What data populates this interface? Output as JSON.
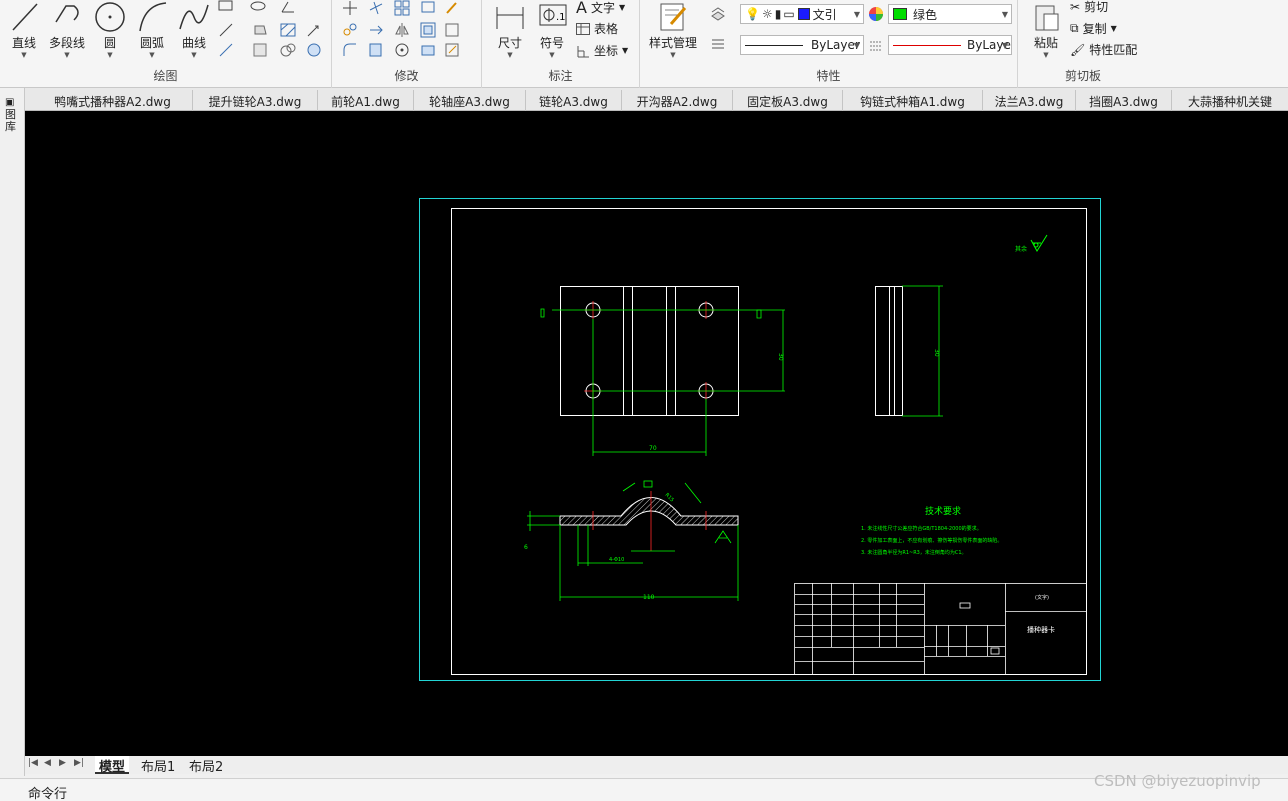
{
  "ribbon": {
    "draw": {
      "title": "绘图",
      "tools": [
        "直线",
        "多段线",
        "圆",
        "圆弧",
        "曲线"
      ]
    },
    "modify": {
      "title": "修改"
    },
    "annotate": {
      "title": "标注",
      "dimension": "尺寸",
      "symbol": "符号",
      "text": "文字",
      "table": "表格",
      "coordinate": "坐标"
    },
    "properties": {
      "title": "特性",
      "style_manager": "样式管理",
      "layer_value": "文引",
      "color_value": "绿色",
      "linetype_value": "ByLayer",
      "lineweight_value": "ByLaye",
      "color_hex": "#00dd00"
    },
    "clipboard": {
      "title": "剪切板",
      "paste": "粘贴",
      "cut": "剪切",
      "copy": "复制",
      "match": "特性匹配"
    }
  },
  "side_panel": {
    "label": "图库"
  },
  "doc_tabs": [
    "鸭嘴式播种器A2.dwg",
    "提升链轮A3.dwg",
    "前轮A1.dwg",
    "轮轴座A3.dwg",
    "链轮A3.dwg",
    "开沟器A2.dwg",
    "固定板A3.dwg",
    "钩链式种箱A1.dwg",
    "法兰A3.dwg",
    "挡圈A3.dwg",
    "大蒜播种机关键"
  ],
  "drawing": {
    "dim_70": "70",
    "dim_110": "110",
    "dim_30a": "30",
    "dim_30b": "30",
    "dim_holes": "4-Φ10",
    "dim_radius": "R15",
    "dim_6": "6",
    "tech_title": "技术要求",
    "tech_lines": [
      "1. 未注线性尺寸公差应符合GB/T1804-2000的要求。",
      "2. 零件加工表面上，不应有划痕、擦伤等损伤零件表面的缺陷。",
      "3. 未注圆角半径为R1~R3，未注倒角均为C1。"
    ],
    "part_name": "播种器卡",
    "roughness_note": "其余",
    "title_block_tag": "(文字)"
  },
  "layout_tabs": [
    "模型",
    "布局1",
    "布局2"
  ],
  "command_label": "命令行",
  "watermark": "CSDN @biyezuopinvip"
}
